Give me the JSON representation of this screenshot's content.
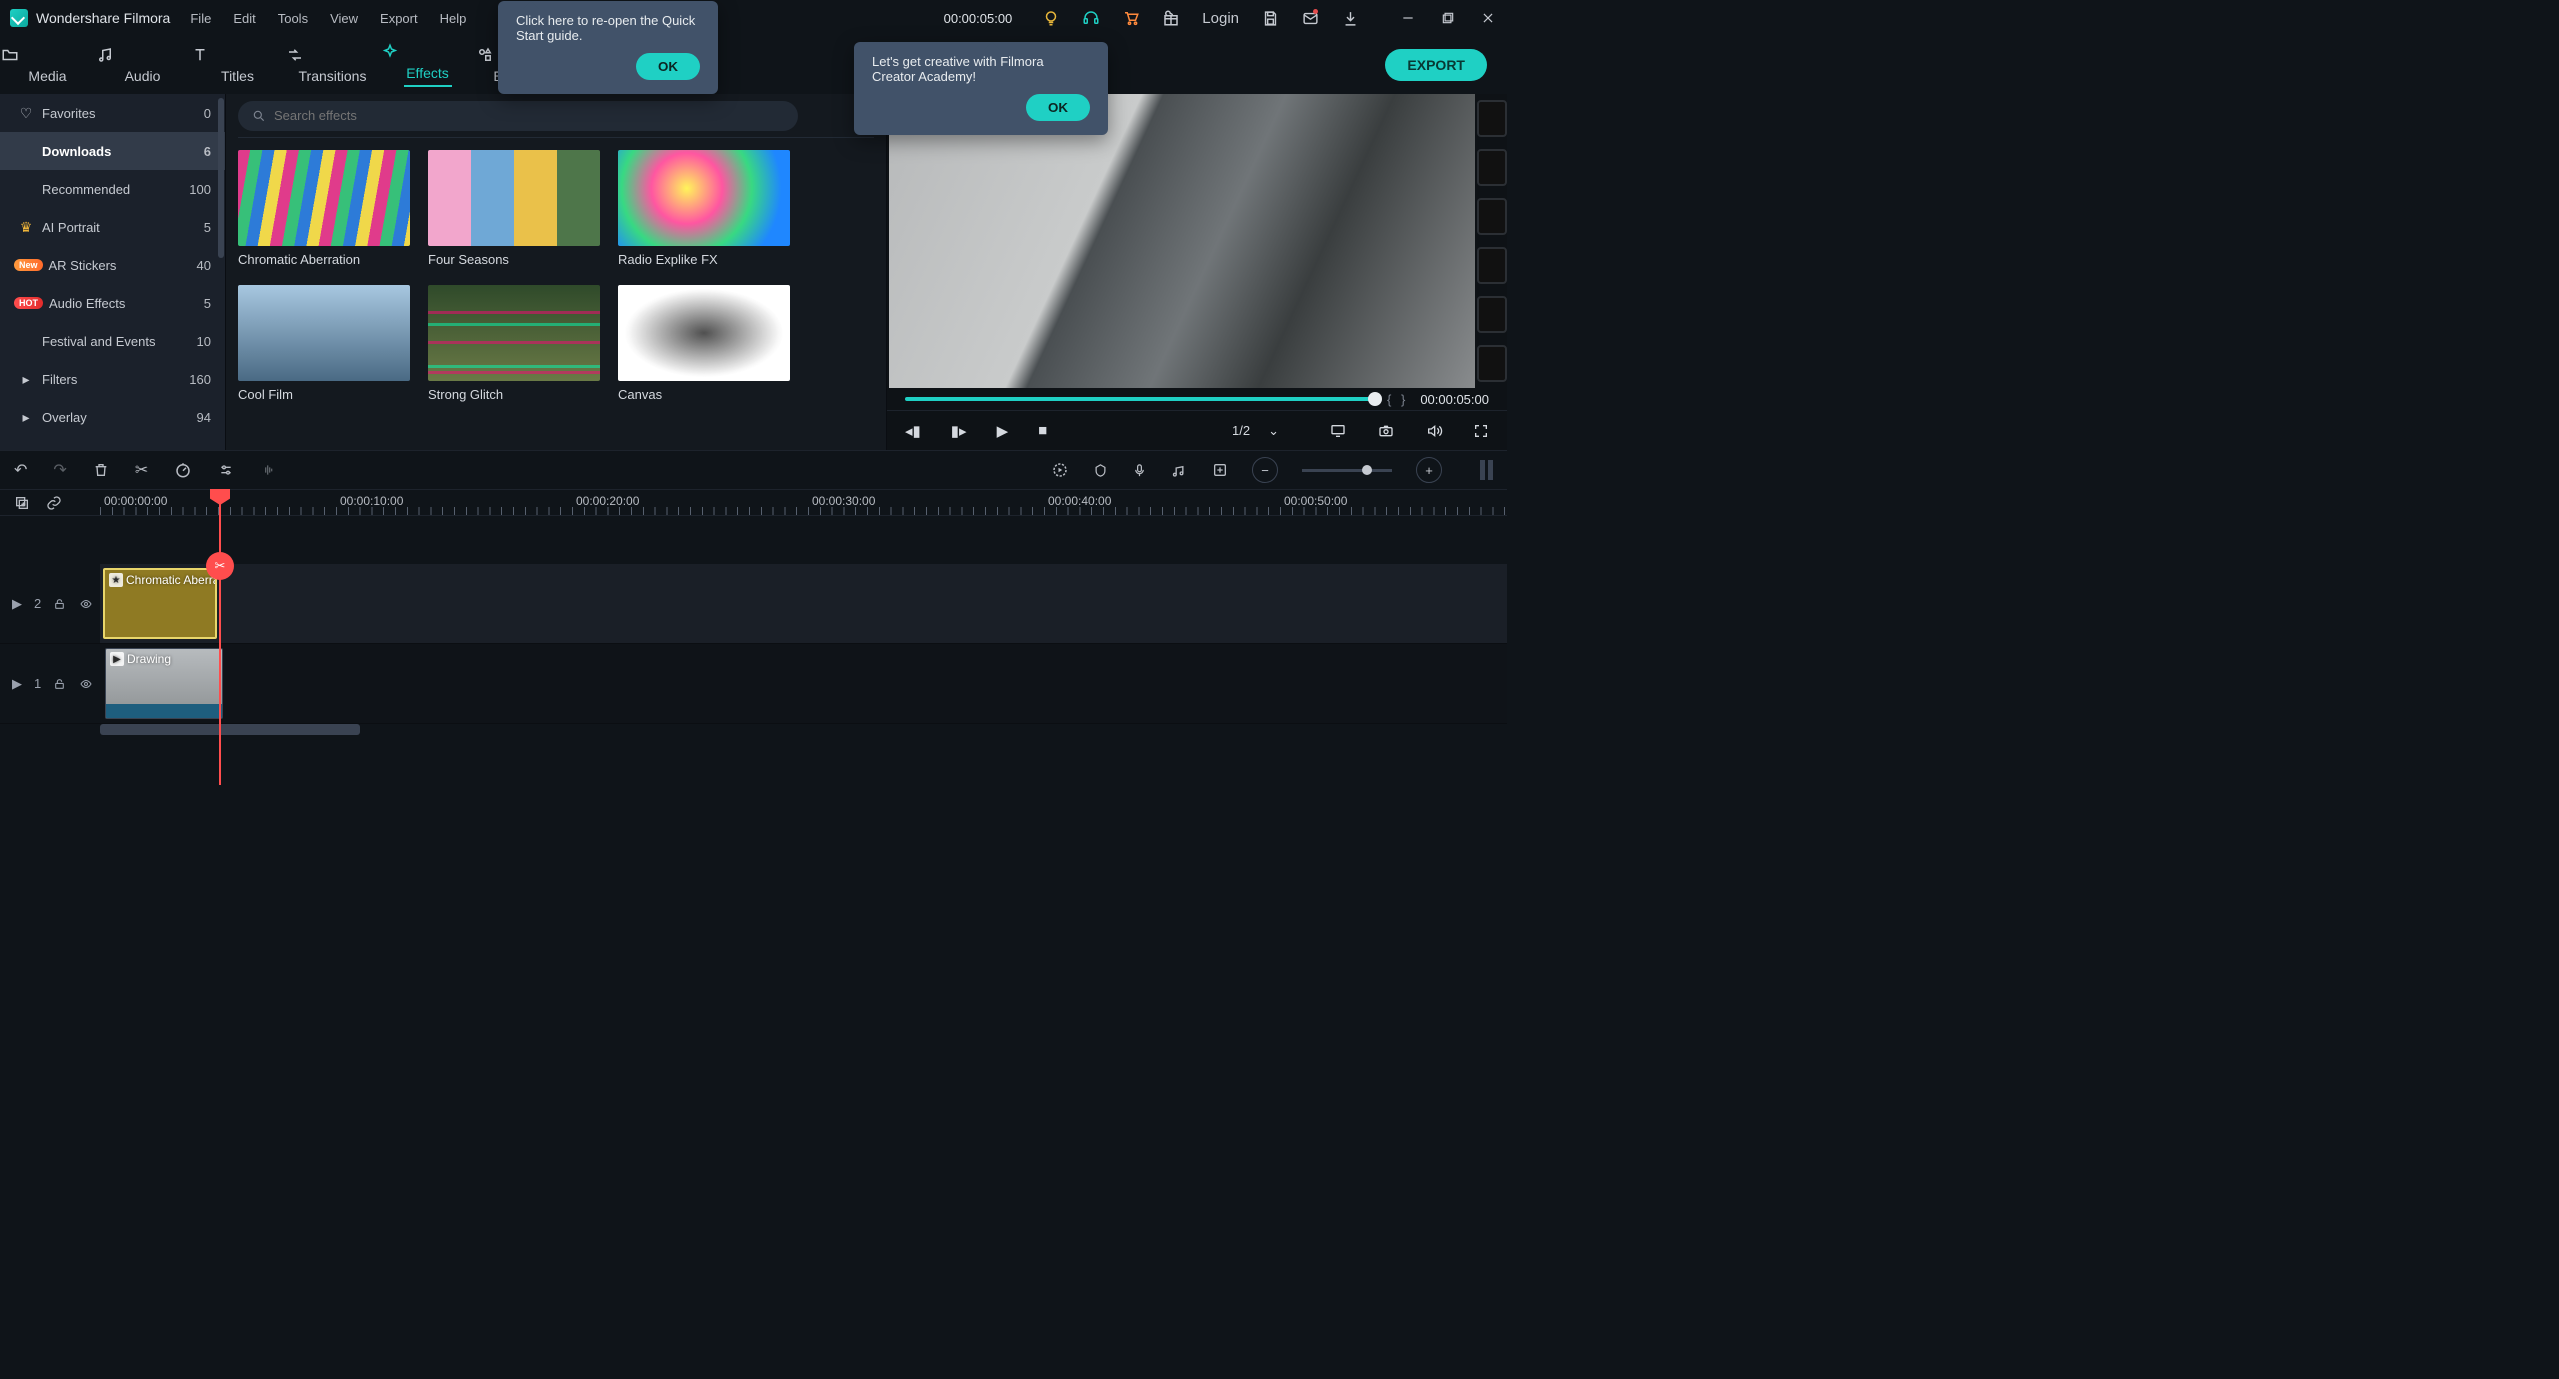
{
  "app": {
    "name": "Wondershare Filmora"
  },
  "menu": [
    "File",
    "Edit",
    "Tools",
    "View",
    "Export",
    "Help"
  ],
  "titlebar": {
    "timecode": "00:00:05:00",
    "login": "Login"
  },
  "tooltips": {
    "quickstart": {
      "text": "Click here to re-open the Quick Start guide.",
      "ok": "OK"
    },
    "academy": {
      "text": "Let's get creative with Filmora Creator Academy!",
      "ok": "OK"
    }
  },
  "tabs": {
    "items": [
      "Media",
      "Audio",
      "Titles",
      "Transitions",
      "Effects",
      "Elements"
    ],
    "active": "Effects",
    "export": "EXPORT"
  },
  "sidebar": [
    {
      "icon": "heart",
      "label": "Favorites",
      "count": "0"
    },
    {
      "icon": "download",
      "label": "Downloads",
      "count": "6",
      "selected": true
    },
    {
      "icon": "",
      "label": "Recommended",
      "count": "100"
    },
    {
      "icon": "crown",
      "label": "AI Portrait",
      "count": "5"
    },
    {
      "icon": "",
      "label": "AR Stickers",
      "count": "40",
      "badge": "New"
    },
    {
      "icon": "",
      "label": "Audio Effects",
      "count": "5",
      "badge": "HOT"
    },
    {
      "icon": "",
      "label": "Festival and Events",
      "count": "10"
    },
    {
      "icon": "chev",
      "label": "Filters",
      "count": "160"
    },
    {
      "icon": "chev",
      "label": "Overlay",
      "count": "94"
    }
  ],
  "search": {
    "placeholder": "Search effects"
  },
  "effects": [
    {
      "name": "Chromatic Aberration",
      "thumb": "t-chrom"
    },
    {
      "name": "Four Seasons",
      "thumb": "t-four"
    },
    {
      "name": "Radio Explike FX",
      "thumb": "t-radio"
    },
    {
      "name": "Cool Film",
      "thumb": "t-cool"
    },
    {
      "name": "Strong Glitch",
      "thumb": "t-glitch"
    },
    {
      "name": "Canvas",
      "thumb": "t-canvas"
    }
  ],
  "preview": {
    "time": "00:00:05:00",
    "braces": "{    }",
    "fraction": "1/2"
  },
  "ruler": [
    "00:00:00:00",
    "00:00:10:00",
    "00:00:20:00",
    "00:00:30:00",
    "00:00:40:00",
    "00:00:50:00"
  ],
  "tracks": {
    "fx": {
      "head": "2",
      "clip": "Chromatic Aberra"
    },
    "vid": {
      "head": "1",
      "clip": "Drawing"
    }
  },
  "icons": {
    "bulb": "bulb",
    "headset": "headset",
    "cart": "cart",
    "gift": "gift",
    "save": "save",
    "mail": "mail",
    "download": "download",
    "minimize": "min",
    "maximize": "max",
    "close": "close"
  }
}
